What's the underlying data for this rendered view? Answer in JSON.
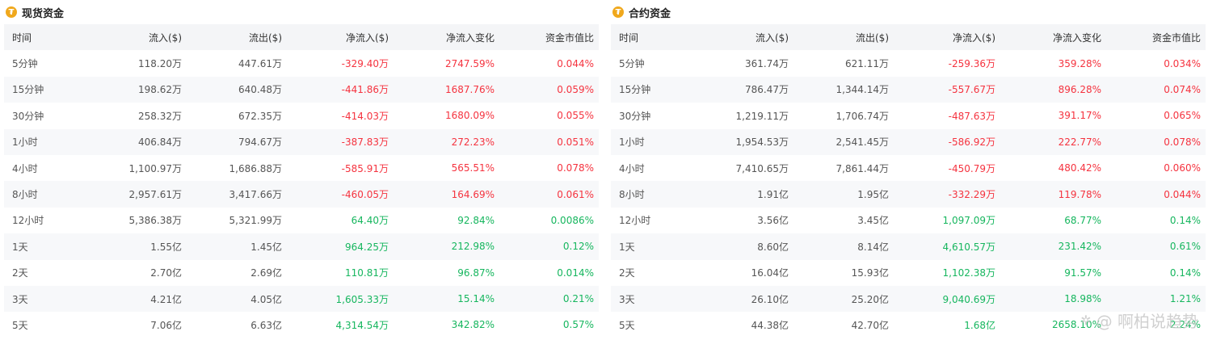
{
  "spot": {
    "title": "现货资金",
    "coin_glyph": "₮",
    "headers": [
      "时间",
      "流入($)",
      "流出($)",
      "净流入($)",
      "净流入变化",
      "资金市值比"
    ],
    "rows": [
      {
        "period": "5分钟",
        "inflow": "118.20万",
        "outflow": "447.61万",
        "net": "-329.40万",
        "change": "2747.59%",
        "ratio": "0.044%",
        "net_sign": "neg",
        "change_sign": "neg",
        "ratio_sign": "neg"
      },
      {
        "period": "15分钟",
        "inflow": "198.62万",
        "outflow": "640.48万",
        "net": "-441.86万",
        "change": "1687.76%",
        "ratio": "0.059%",
        "net_sign": "neg",
        "change_sign": "neg",
        "ratio_sign": "neg"
      },
      {
        "period": "30分钟",
        "inflow": "258.32万",
        "outflow": "672.35万",
        "net": "-414.03万",
        "change": "1680.09%",
        "ratio": "0.055%",
        "net_sign": "neg",
        "change_sign": "neg",
        "ratio_sign": "neg"
      },
      {
        "period": "1小时",
        "inflow": "406.84万",
        "outflow": "794.67万",
        "net": "-387.83万",
        "change": "272.23%",
        "ratio": "0.051%",
        "net_sign": "neg",
        "change_sign": "neg",
        "ratio_sign": "neg"
      },
      {
        "period": "4小时",
        "inflow": "1,100.97万",
        "outflow": "1,686.88万",
        "net": "-585.91万",
        "change": "565.51%",
        "ratio": "0.078%",
        "net_sign": "neg",
        "change_sign": "neg",
        "ratio_sign": "neg"
      },
      {
        "period": "8小时",
        "inflow": "2,957.61万",
        "outflow": "3,417.66万",
        "net": "-460.05万",
        "change": "164.69%",
        "ratio": "0.061%",
        "net_sign": "neg",
        "change_sign": "neg",
        "ratio_sign": "neg"
      },
      {
        "period": "12小时",
        "inflow": "5,386.38万",
        "outflow": "5,321.99万",
        "net": "64.40万",
        "change": "92.84%",
        "ratio": "0.0086%",
        "net_sign": "pos",
        "change_sign": "pos",
        "ratio_sign": "pos"
      },
      {
        "period": "1天",
        "inflow": "1.55亿",
        "outflow": "1.45亿",
        "net": "964.25万",
        "change": "212.98%",
        "ratio": "0.12%",
        "net_sign": "pos",
        "change_sign": "pos",
        "ratio_sign": "pos"
      },
      {
        "period": "2天",
        "inflow": "2.70亿",
        "outflow": "2.69亿",
        "net": "110.81万",
        "change": "96.87%",
        "ratio": "0.014%",
        "net_sign": "pos",
        "change_sign": "pos",
        "ratio_sign": "pos"
      },
      {
        "period": "3天",
        "inflow": "4.21亿",
        "outflow": "4.05亿",
        "net": "1,605.33万",
        "change": "15.14%",
        "ratio": "0.21%",
        "net_sign": "pos",
        "change_sign": "pos",
        "ratio_sign": "pos"
      },
      {
        "period": "5天",
        "inflow": "7.06亿",
        "outflow": "6.63亿",
        "net": "4,314.54万",
        "change": "342.82%",
        "ratio": "0.57%",
        "net_sign": "pos",
        "change_sign": "pos",
        "ratio_sign": "pos"
      }
    ]
  },
  "futures": {
    "title": "合约资金",
    "coin_glyph": "₮",
    "headers": [
      "时间",
      "流入($)",
      "流出($)",
      "净流入($)",
      "净流入变化",
      "资金市值比"
    ],
    "rows": [
      {
        "period": "5分钟",
        "inflow": "361.74万",
        "outflow": "621.11万",
        "net": "-259.36万",
        "change": "359.28%",
        "ratio": "0.034%",
        "net_sign": "neg",
        "change_sign": "neg",
        "ratio_sign": "neg"
      },
      {
        "period": "15分钟",
        "inflow": "786.47万",
        "outflow": "1,344.14万",
        "net": "-557.67万",
        "change": "896.28%",
        "ratio": "0.074%",
        "net_sign": "neg",
        "change_sign": "neg",
        "ratio_sign": "neg"
      },
      {
        "period": "30分钟",
        "inflow": "1,219.11万",
        "outflow": "1,706.74万",
        "net": "-487.63万",
        "change": "391.17%",
        "ratio": "0.065%",
        "net_sign": "neg",
        "change_sign": "neg",
        "ratio_sign": "neg"
      },
      {
        "period": "1小时",
        "inflow": "1,954.53万",
        "outflow": "2,541.45万",
        "net": "-586.92万",
        "change": "222.77%",
        "ratio": "0.078%",
        "net_sign": "neg",
        "change_sign": "neg",
        "ratio_sign": "neg"
      },
      {
        "period": "4小时",
        "inflow": "7,410.65万",
        "outflow": "7,861.44万",
        "net": "-450.79万",
        "change": "480.42%",
        "ratio": "0.060%",
        "net_sign": "neg",
        "change_sign": "neg",
        "ratio_sign": "neg"
      },
      {
        "period": "8小时",
        "inflow": "1.91亿",
        "outflow": "1.95亿",
        "net": "-332.29万",
        "change": "119.78%",
        "ratio": "0.044%",
        "net_sign": "neg",
        "change_sign": "neg",
        "ratio_sign": "neg"
      },
      {
        "period": "12小时",
        "inflow": "3.56亿",
        "outflow": "3.45亿",
        "net": "1,097.09万",
        "change": "68.77%",
        "ratio": "0.14%",
        "net_sign": "pos",
        "change_sign": "pos",
        "ratio_sign": "pos"
      },
      {
        "period": "1天",
        "inflow": "8.60亿",
        "outflow": "8.14亿",
        "net": "4,610.57万",
        "change": "231.42%",
        "ratio": "0.61%",
        "net_sign": "pos",
        "change_sign": "pos",
        "ratio_sign": "pos"
      },
      {
        "period": "2天",
        "inflow": "16.04亿",
        "outflow": "15.93亿",
        "net": "1,102.38万",
        "change": "91.57%",
        "ratio": "0.14%",
        "net_sign": "pos",
        "change_sign": "pos",
        "ratio_sign": "pos"
      },
      {
        "period": "3天",
        "inflow": "26.10亿",
        "outflow": "25.20亿",
        "net": "9,040.69万",
        "change": "18.98%",
        "ratio": "1.21%",
        "net_sign": "pos",
        "change_sign": "pos",
        "ratio_sign": "pos"
      },
      {
        "period": "5天",
        "inflow": "44.38亿",
        "outflow": "42.70亿",
        "net": "1.68亿",
        "change": "2658.10%",
        "ratio": "2.24%",
        "net_sign": "pos",
        "change_sign": "pos",
        "ratio_sign": "pos"
      }
    ]
  },
  "colors": {
    "positive": "#16b65e",
    "negative": "#f5333f",
    "coin": "#f0a81c",
    "header_bg": "#f4f5f7"
  },
  "watermark": {
    "text": "@ 啊柏说趋势",
    "icon": "wechat-icon"
  }
}
